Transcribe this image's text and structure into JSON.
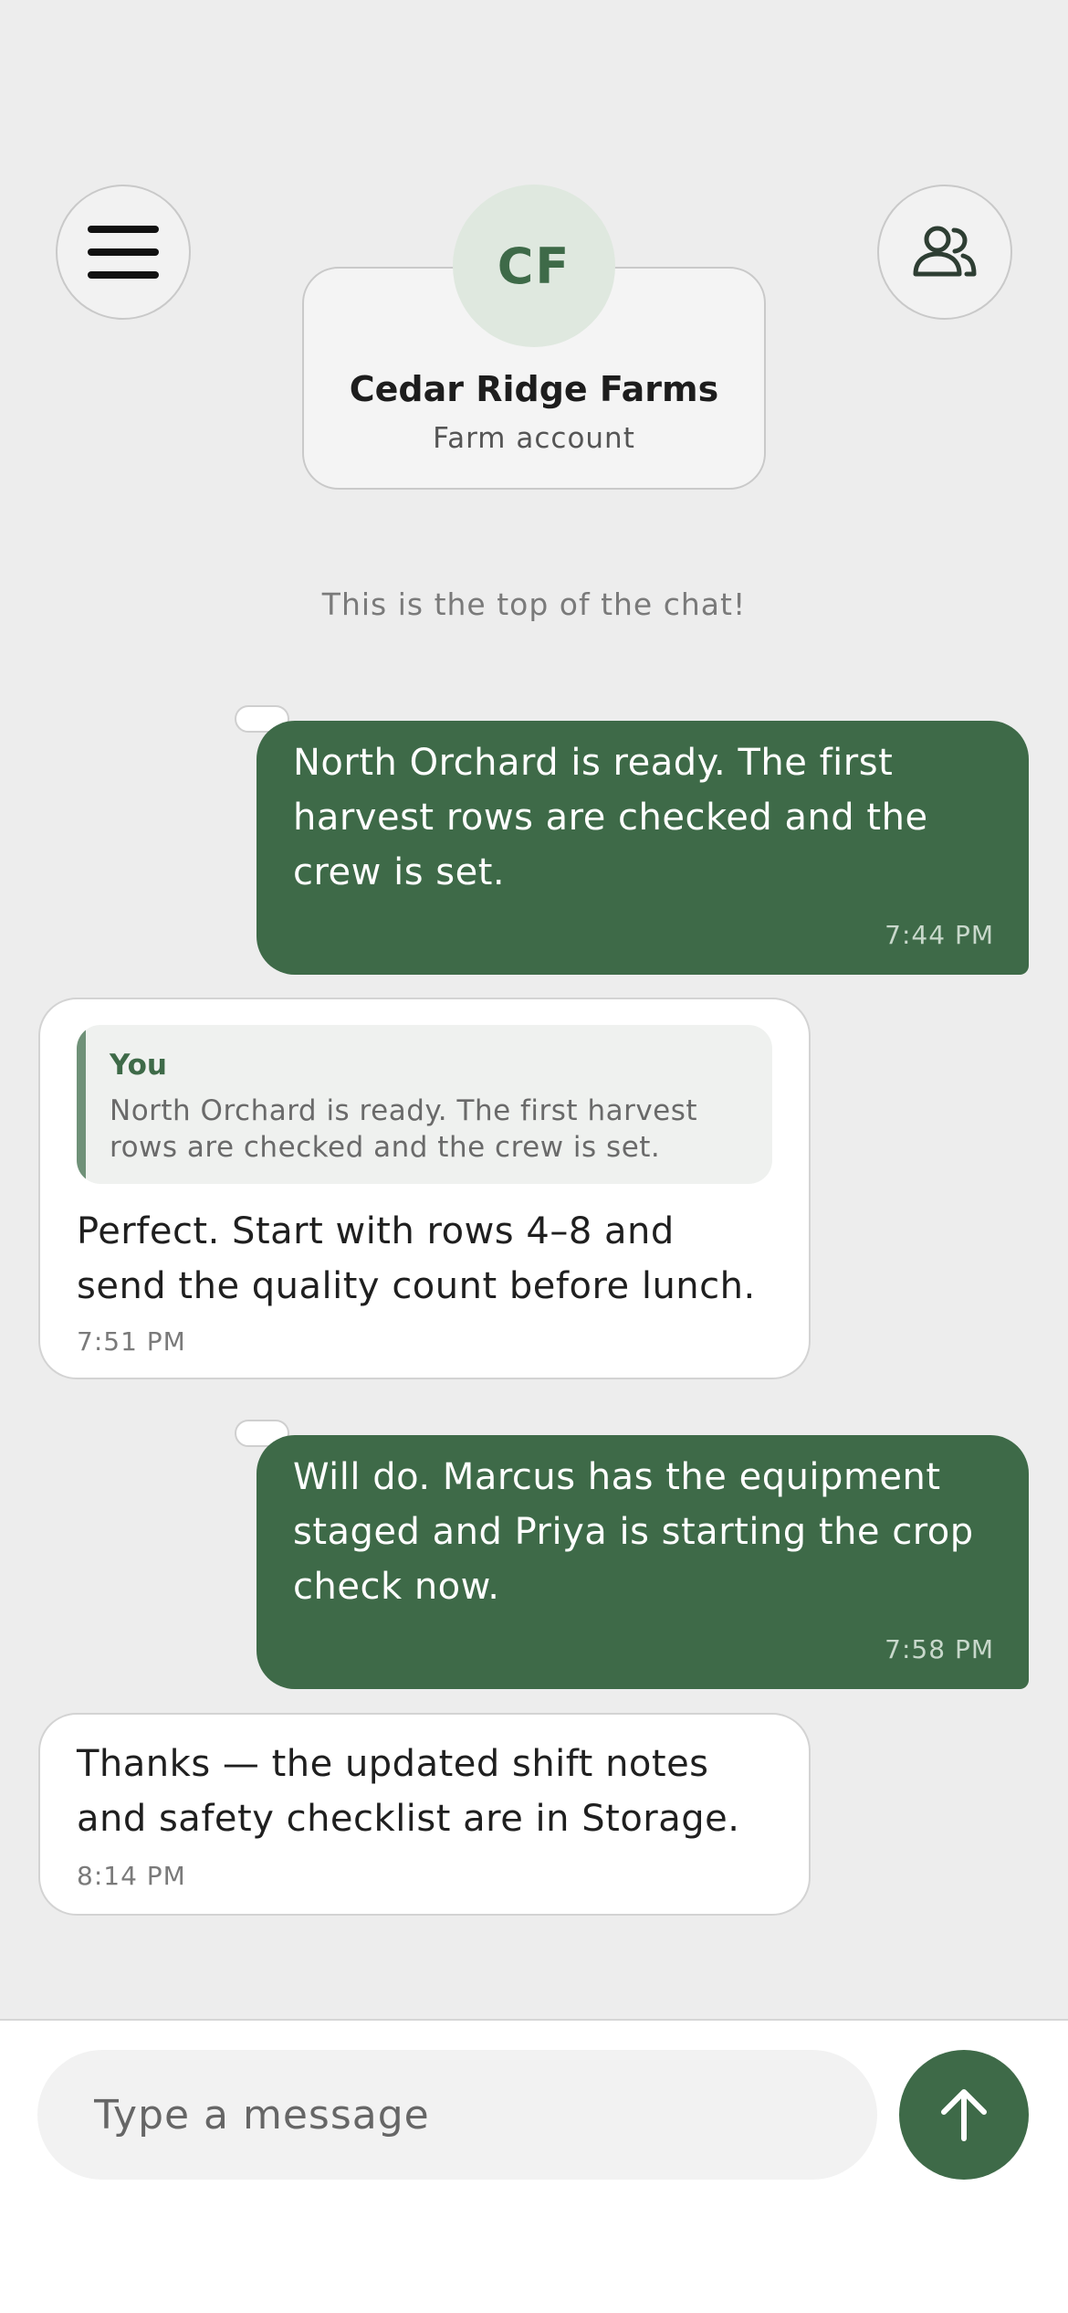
{
  "header": {
    "menu_icon": "hamburger-menu-icon",
    "people_icon": "people-icon",
    "avatar_initials": "CF",
    "contact_name": "Cedar Ridge Farms",
    "contact_subtitle": "Farm account"
  },
  "chat": {
    "top_notice": "This is the top of the chat!",
    "messages": [
      {
        "direction": "outgoing",
        "text": "North Orchard is ready. The first harvest rows are checked and the crew is set.",
        "lines": [
          "North Orchard is ready. The first",
          "harvest rows are checked and the",
          "crew is set."
        ],
        "time": "7:44 PM"
      },
      {
        "direction": "incoming",
        "reply_to": {
          "author": "You",
          "text": "North Orchard is ready. The first harvest rows are checked and the crew is set.",
          "lines": [
            "North Orchard is ready. The first harvest",
            "rows are checked and the crew is set."
          ]
        },
        "text": "Perfect. Start with rows 4–8 and send the quality count before lunch.",
        "lines": [
          "Perfect. Start with rows 4–8 and",
          "send the quality count before lunch."
        ],
        "time": "7:51 PM"
      },
      {
        "direction": "outgoing",
        "text": "Will do. Marcus has the equipment staged and Priya is starting the crop check now.",
        "lines": [
          "Will do. Marcus has the equipment",
          "staged and Priya is starting the crop",
          "check now."
        ],
        "time": "7:58 PM"
      },
      {
        "direction": "incoming",
        "text": "Thanks — the updated shift notes and safety checklist are in Storage.",
        "lines": [
          "Thanks — the updated shift notes",
          "and safety checklist are in Storage."
        ],
        "time": "8:14 PM"
      }
    ]
  },
  "composer": {
    "placeholder": "Type a message",
    "value": "",
    "send_icon": "arrow-up-icon"
  },
  "colors": {
    "accent": "#3e6a48",
    "background": "#ededed",
    "incoming_bubble": "#ffffff"
  }
}
